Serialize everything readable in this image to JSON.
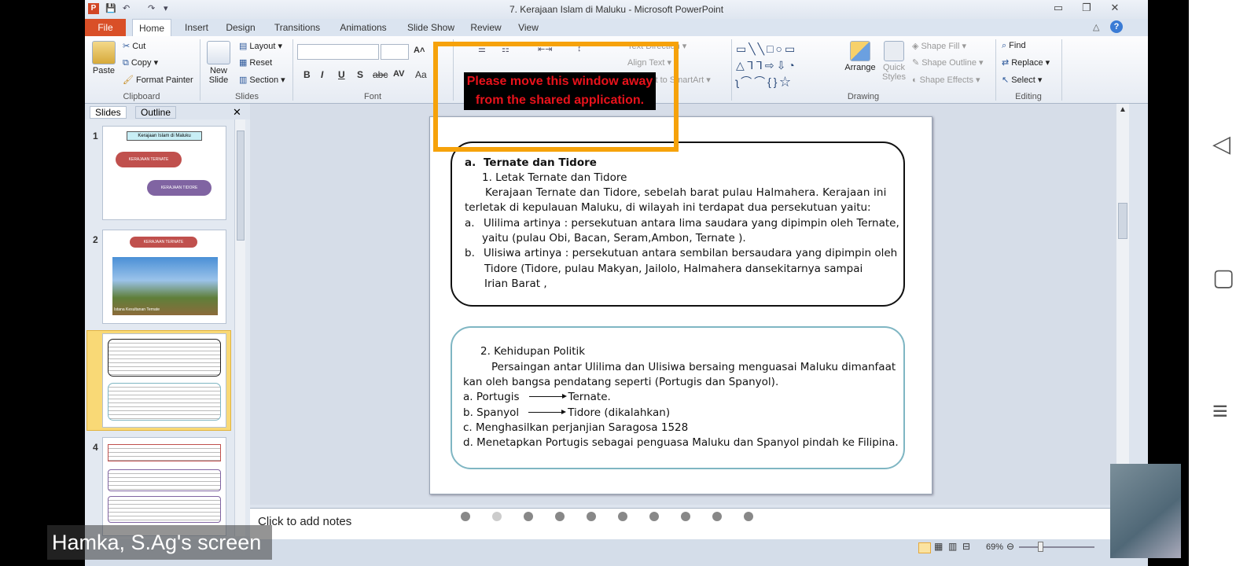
{
  "window": {
    "title": "7. Kerajaan Islam di Maluku - Microsoft PowerPoint",
    "min": "▭",
    "restore": "❐",
    "close": "✕"
  },
  "tabs": [
    "File",
    "Home",
    "Insert",
    "Design",
    "Transitions",
    "Animations",
    "Slide Show",
    "Review",
    "View"
  ],
  "clipboard": {
    "paste": "Paste",
    "cut": "Cut",
    "copy": "Copy",
    "format_painter": "Format Painter",
    "label": "Clipboard"
  },
  "slides_group": {
    "new_slide": "New Slide",
    "layout": "Layout",
    "reset": "Reset",
    "section": "Section",
    "label": "Slides"
  },
  "font_group": {
    "label": "Font",
    "bold": "B",
    "italic": "I",
    "underline": "U",
    "shadow": "S",
    "strike": "abc",
    "spacing": "AV",
    "case": "Aa"
  },
  "paragraph_group": {
    "text_direction": "Text Direction",
    "align_text": "Align Text",
    "convert_smartart": "Convert to SmartArt"
  },
  "drawing": {
    "label": "Drawing",
    "arrange": "Arrange",
    "quick_styles": "Quick Styles",
    "shape_fill": "Shape Fill",
    "shape_outline": "Shape Outline",
    "shape_effects": "Shape Effects"
  },
  "editing": {
    "label": "Editing",
    "find": "Find",
    "replace": "Replace",
    "select": "Select"
  },
  "overlay": {
    "warning": "Please move this window away from the shared application."
  },
  "pane": {
    "tabs": [
      "Slides",
      "Outline"
    ],
    "close": "✕"
  },
  "thumbnails": [
    {
      "num": "1",
      "title": "Kerajaan Islam di Maluku",
      "items": [
        "KERAJAAN TERNATE",
        "KERAJAAN TIDORE"
      ]
    },
    {
      "num": "2",
      "title": "KERAJAAN TERNATE",
      "caption": "Istana Kesultanan Ternate"
    },
    {
      "num": "3"
    },
    {
      "num": "4"
    }
  ],
  "slide": {
    "box1": {
      "heading_letter": "a.",
      "heading": "Ternate dan Tidore",
      "sub": "1. Letak Ternate dan Tidore",
      "para_l1": "Kerajaan Ternate dan Tidore, sebelah barat pulau Halmahera. Kerajaan ini",
      "para_l2": "terletak di kepulauan Maluku, di wilayah ini terdapat dua persekutuan yaitu:",
      "a_letter": "a.",
      "a_l1": "Ulilima artinya : persekutuan antara lima saudara yang dipimpin oleh Ternate,",
      "a_l2": "yaitu (pulau Obi, Bacan, Seram,Ambon, Ternate ).",
      "b_letter": "b.",
      "b_l1": "Ulisiwa  artinya : persekutuan antara sembilan bersaudara yang dipimpin oleh",
      "b_l2": "Tidore  (Tidore, pulau Makyan, Jailolo, Halmahera dansekitarnya sampai",
      "b_l3": "Irian Barat ,"
    },
    "box2": {
      "sub": "2. Kehidupan Politik",
      "para_l1": "Persaingan antar Ulilima dan Ulisiwa bersaing menguasai Maluku  dimanfaat",
      "para_l2": "kan oleh bangsa pendatang seperti (Portugis dan Spanyol).",
      "a_left": "a. Portugis",
      "a_right": "Ternate.",
      "b_left": "b. Spanyol",
      "b_right": "Tidore (dikalahkan)",
      "c": "c. Menghasilkan perjanjian Saragosa 1528",
      "d": "d. Menetapkan Portugis sebagai penguasa Maluku dan Spanyol pindah ke Filipina."
    }
  },
  "notes": {
    "placeholder": "Click to add notes"
  },
  "status": {
    "zoom": "69%"
  },
  "share": {
    "caption": "Hamka, S.Ag's screen"
  },
  "android": {
    "back": "◁",
    "home": "▢",
    "menu": "≡"
  }
}
